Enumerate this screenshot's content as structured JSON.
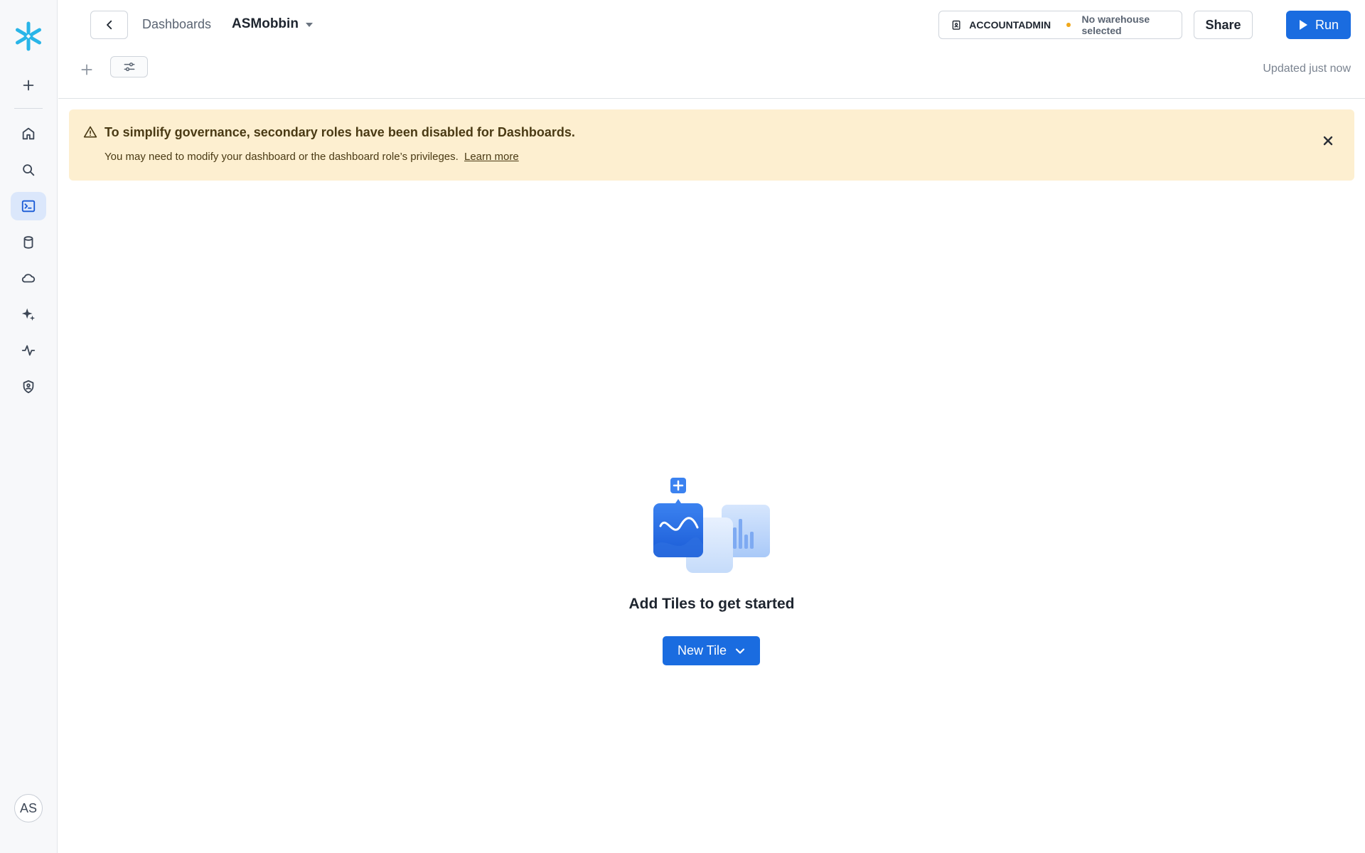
{
  "sidebar": {
    "items": [
      {
        "name": "create",
        "icon": "plus-icon"
      },
      {
        "name": "home",
        "icon": "home-icon"
      },
      {
        "name": "search",
        "icon": "search-icon"
      },
      {
        "name": "projects",
        "icon": "terminal-icon",
        "active": true
      },
      {
        "name": "data",
        "icon": "database-icon"
      },
      {
        "name": "data-products",
        "icon": "cloud-icon"
      },
      {
        "name": "ai-ml",
        "icon": "sparkle-icon"
      },
      {
        "name": "monitoring",
        "icon": "activity-icon"
      },
      {
        "name": "admin",
        "icon": "shield-icon"
      }
    ],
    "avatar_initials": "AS"
  },
  "header": {
    "breadcrumb": "Dashboards",
    "dashboard_name": "ASMobbin",
    "role": "ACCOUNTADMIN",
    "warehouse": "No warehouse selected",
    "share_label": "Share",
    "run_label": "Run",
    "updated_text": "Updated just now"
  },
  "banner": {
    "title": "To simplify governance, secondary roles have been disabled for Dashboards.",
    "text": "You may need to modify your dashboard or the dashboard role’s privileges.",
    "link": "Learn more"
  },
  "empty_state": {
    "title": "Add Tiles to get started",
    "button_label": "New Tile"
  },
  "colors": {
    "accent": "#1a6ce0",
    "banner_bg": "#fdefd0",
    "brand": "#29b5e8",
    "warehouse_dot": "#f0a81c"
  }
}
